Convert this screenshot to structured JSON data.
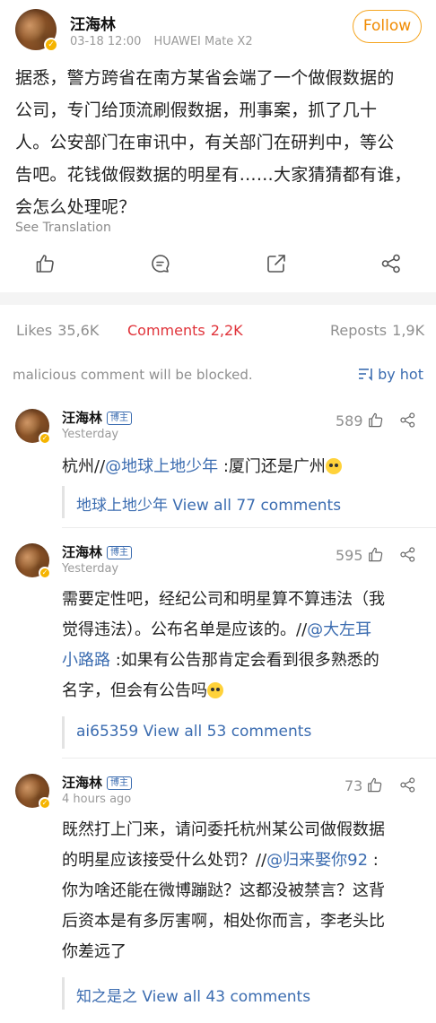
{
  "post": {
    "author": "汪海林",
    "date": "03-18 12:00",
    "device": "HUAWEI Mate X2",
    "follow_label": "Follow",
    "lines": [
      "据悉，警方跨省在南方某省会端了一个做假数据的",
      "公司，专门给顶流刷假数据，刑事案，抓了几十",
      "人。公安部门在审讯中，有关部门在研判中，等公",
      "告吧。花钱做假数据的明星有……大家猜猜都有谁，",
      "会怎么处理呢？"
    ],
    "see_translation": "See Translation",
    "actions": {
      "like_icon": "thumbs-up-icon",
      "comment_icon": "comment-icon",
      "repost_icon": "repost-icon",
      "share_icon": "share-icon"
    }
  },
  "tabs": {
    "likes": {
      "label": "Likes",
      "count": "35,6K"
    },
    "comments": {
      "label": "Comments",
      "count": "2,2K"
    },
    "reposts": {
      "label": "Reposts",
      "count": "1,9K"
    }
  },
  "notice": "malicious comment will be blocked.",
  "sort_label": "by hot",
  "comments": [
    {
      "name": "汪海林",
      "tag": "博主",
      "time": "Yesterday",
      "likes": "589",
      "lines": [
        {
          "text": "杭州//",
          "mention": "@地球上地少年",
          "rest": " :厦门还是广州"
        }
      ],
      "sub_user": "地球上地少年",
      "sub_link": "View all 77 comments"
    },
    {
      "name": "汪海林",
      "tag": "博主",
      "time": "Yesterday",
      "likes": "595",
      "lines": [
        {
          "text": "需要定性吧，经纪公司和明星算不算违法（我"
        },
        {
          "text": "觉得违法）。公布名单是应该的。//",
          "mention": "@大左耳"
        },
        {
          "mention": "小路路",
          "rest": " :如果有公告那肯定会看到很多熟悉的"
        },
        {
          "text": "名字，但会有公告吗"
        }
      ],
      "sub_user": "ai65359",
      "sub_link": "View all 53 comments"
    },
    {
      "name": "汪海林",
      "tag": "博主",
      "time": "4 hours ago",
      "likes": "73",
      "lines": [
        {
          "text": "既然打上门来，请问委托杭州某公司做假数据"
        },
        {
          "text": "的明星应该接受什么处罚？//",
          "mention": "@归来娶你92",
          "rest": " :"
        },
        {
          "text": "你为啥还能在微博蹦跶？这都没被禁言？这背"
        },
        {
          "text": "后资本是有多厉害啊，相处你而言，李老头比"
        },
        {
          "text": "你差远了"
        }
      ],
      "sub_user": "知之是之",
      "sub_link": "View all 43 comments"
    }
  ],
  "colors": {
    "accent_red": "#e0333a",
    "link_blue": "#3b6cb0",
    "follow_orange": "#f5a623"
  }
}
